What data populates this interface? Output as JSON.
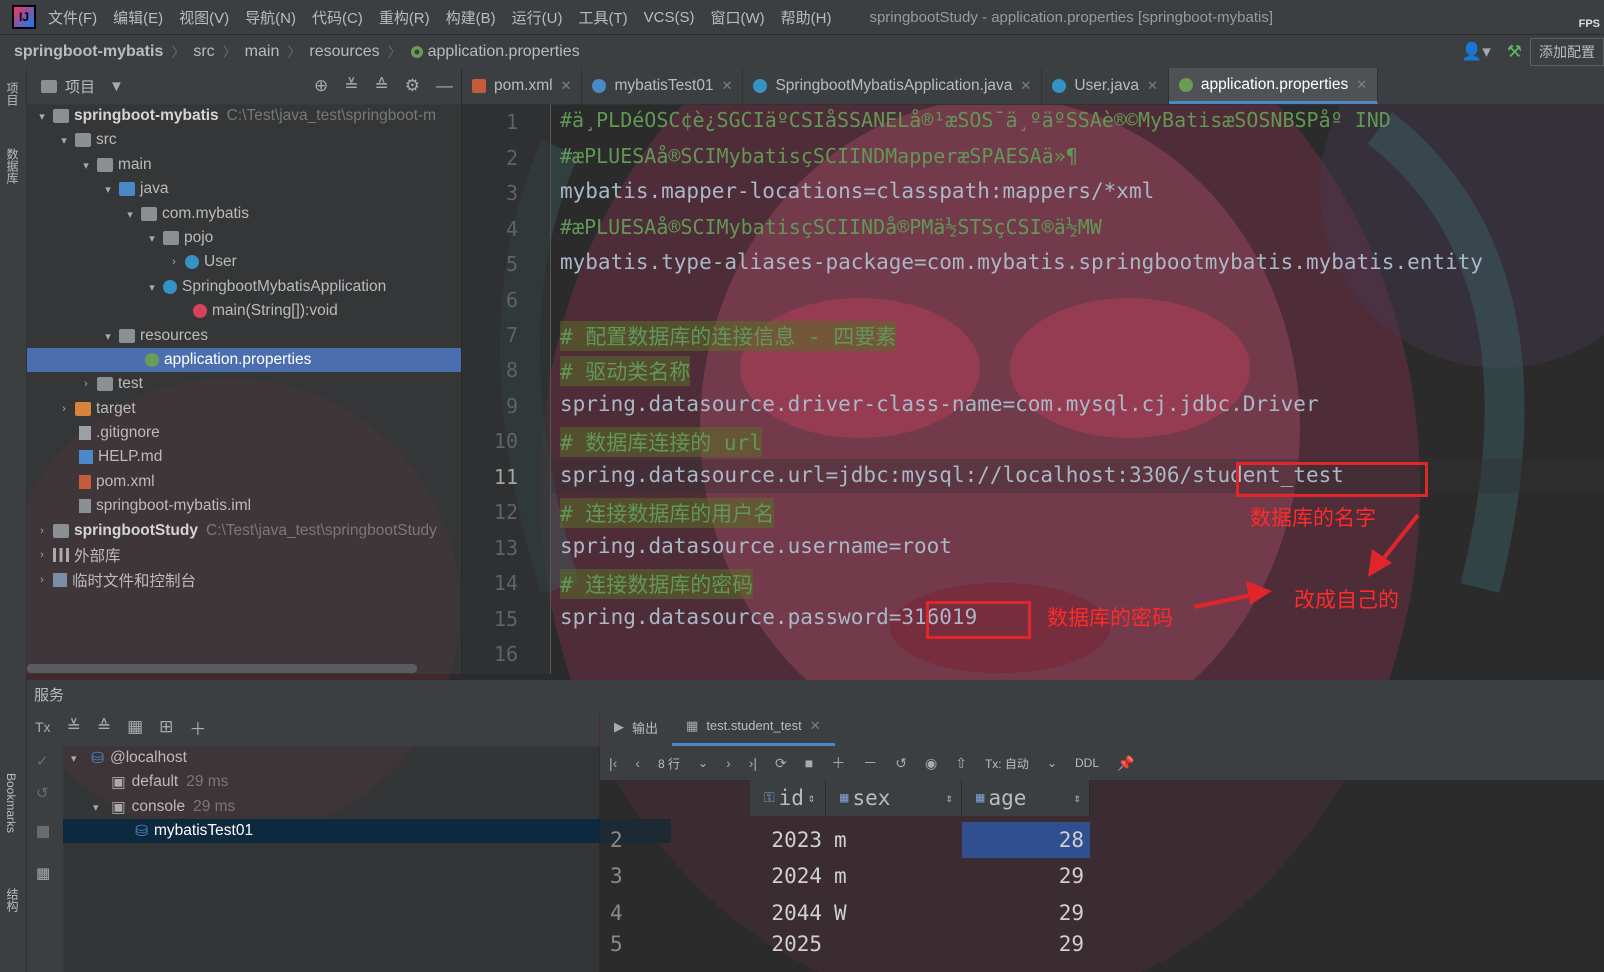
{
  "menu": {
    "logo": "IJ",
    "items": [
      "文件(F)",
      "编辑(E)",
      "视图(V)",
      "导航(N)",
      "代码(C)",
      "重构(R)",
      "构建(B)",
      "运行(U)",
      "工具(T)",
      "VCS(S)",
      "窗口(W)",
      "帮助(H)"
    ],
    "window_title": "springbootStudy - application.properties [springboot-mybatis]",
    "fps": "FPS"
  },
  "breadcrumb": [
    "springboot-mybatis",
    "src",
    "main",
    "resources",
    "application.properties"
  ],
  "navbar": {
    "add_config": "添加配置"
  },
  "left_strip": {
    "project": "项目",
    "database": "数据库",
    "bookmarks": "Bookmarks",
    "structure": "结构"
  },
  "project": {
    "title": "项目",
    "tree": [
      {
        "label": "springboot-mybatis",
        "path": "C:\\Test\\java_test\\springboot-m"
      },
      {
        "label": "src"
      },
      {
        "label": "main"
      },
      {
        "label": "java"
      },
      {
        "label": "com.mybatis"
      },
      {
        "label": "pojo"
      },
      {
        "label": "User"
      },
      {
        "label": "SpringbootMybatisApplication"
      },
      {
        "label": "main(String[]):void"
      },
      {
        "label": "resources"
      },
      {
        "label": "application.properties"
      },
      {
        "label": "test"
      },
      {
        "label": "target"
      },
      {
        "label": ".gitignore"
      },
      {
        "label": "HELP.md"
      },
      {
        "label": "pom.xml"
      },
      {
        "label": "springboot-mybatis.iml"
      },
      {
        "label": "springbootStudy",
        "path": "C:\\Test\\java_test\\springbootStudy"
      },
      {
        "label": "外部库"
      },
      {
        "label": "临时文件和控制台"
      }
    ]
  },
  "editor": {
    "tabs": [
      "pom.xml",
      "mybatisTest01",
      "SpringbootMybatisApplication.java",
      "User.java",
      "application.properties"
    ],
    "lines": [
      "#ä¸PLDéOSC¢è¿SGCIäºCSIåSSANELå®¹æSOS¯ä¸ºäºSSAè®©MyBatisæSOSNBSPåº IND",
      "#æPLUESAå®SCIMybatisçSCIINDMapperæSPAESAä»¶",
      "mybatis.mapper-locations=classpath:mappers/*xml",
      "#æPLUESAå®SCIMybatisçSCIINDå®PMä½STSçCSI®ä½MW",
      "mybatis.type-aliases-package=com.mybatis.springbootmybatis.mybatis.entity",
      "",
      "# 配置数据库的连接信息 - 四要素",
      "# 驱动类名称",
      "spring.datasource.driver-class-name=com.mysql.cj.jdbc.Driver",
      "# 数据库连接的 url",
      "spring.datasource.url=jdbc:mysql://localhost:3306/student_test",
      "# 连接数据库的用户名",
      "spring.datasource.username=root",
      "# 连接数据库的密码",
      "spring.datasource.password=316019",
      ""
    ],
    "line_numbers": [
      "1",
      "2",
      "3",
      "4",
      "5",
      "6",
      "7",
      "8",
      "9",
      "10",
      "11",
      "12",
      "13",
      "14",
      "15",
      "16"
    ]
  },
  "annotations": {
    "db_name": "数据库的名字",
    "db_password": "数据库的密码",
    "change_own": "改成自己的"
  },
  "services": {
    "title": "服务",
    "tree": [
      {
        "label": "@localhost"
      },
      {
        "label": "default",
        "ms": "29 ms"
      },
      {
        "label": "console",
        "ms": "29 ms"
      },
      {
        "label": "mybatisTest01"
      }
    ],
    "tx": "Tx"
  },
  "results": {
    "tabs": [
      "输出",
      "test.student_test"
    ],
    "rows_label": "8 行",
    "tx_mode": "Tx: 自动",
    "ddl": "DDL",
    "columns": [
      "id",
      "sex",
      "age"
    ],
    "rows": [
      {
        "n": "2",
        "id": "2023",
        "sex": "m",
        "age": "28"
      },
      {
        "n": "3",
        "id": "2024",
        "sex": "m",
        "age": "29"
      },
      {
        "n": "4",
        "id": "2044",
        "sex": "W",
        "age": "29"
      },
      {
        "n": "5",
        "id": "2025",
        "sex": "",
        "age": "29"
      }
    ]
  },
  "colors": {
    "selection": "#4b6eaf",
    "accent": "#4a88c7",
    "annotation": "#e0262b",
    "comment": "#629755",
    "key": "#cc7832"
  }
}
